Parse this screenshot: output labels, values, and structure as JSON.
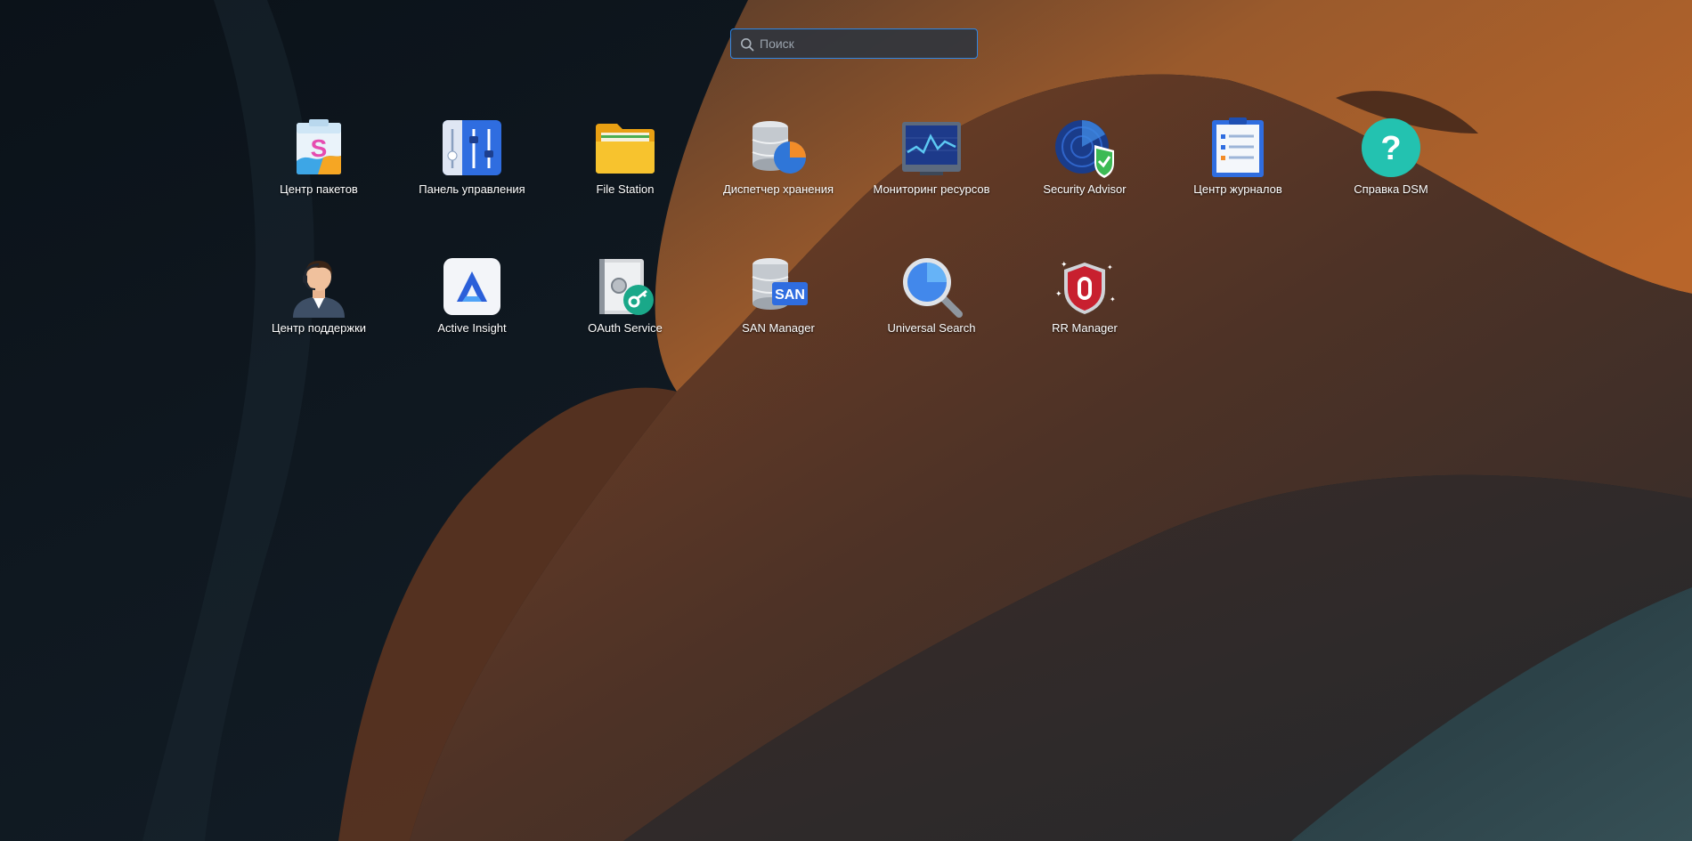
{
  "search": {
    "placeholder": "Поиск",
    "value": ""
  },
  "apps": [
    {
      "label": "Центр пакетов",
      "icon": "package-center-icon"
    },
    {
      "label": "Панель управления",
      "icon": "control-panel-icon"
    },
    {
      "label": "File Station",
      "icon": "folder-icon"
    },
    {
      "label": "Диспетчер хранения",
      "icon": "storage-manager-icon"
    },
    {
      "label": "Мониторинг ресурсов",
      "icon": "resource-monitor-icon"
    },
    {
      "label": "Security Advisor",
      "icon": "security-advisor-icon"
    },
    {
      "label": "Центр журналов",
      "icon": "log-center-icon"
    },
    {
      "label": "Справка DSM",
      "icon": "help-icon"
    },
    {
      "label": "Центр поддержки",
      "icon": "support-agent-icon"
    },
    {
      "label": "Active Insight",
      "icon": "active-insight-icon"
    },
    {
      "label": "OAuth Service",
      "icon": "oauth-safe-icon"
    },
    {
      "label": "SAN Manager",
      "icon": "san-manager-icon"
    },
    {
      "label": "Universal Search",
      "icon": "universal-search-icon"
    },
    {
      "label": "RR Manager",
      "icon": "rr-shield-icon"
    }
  ]
}
